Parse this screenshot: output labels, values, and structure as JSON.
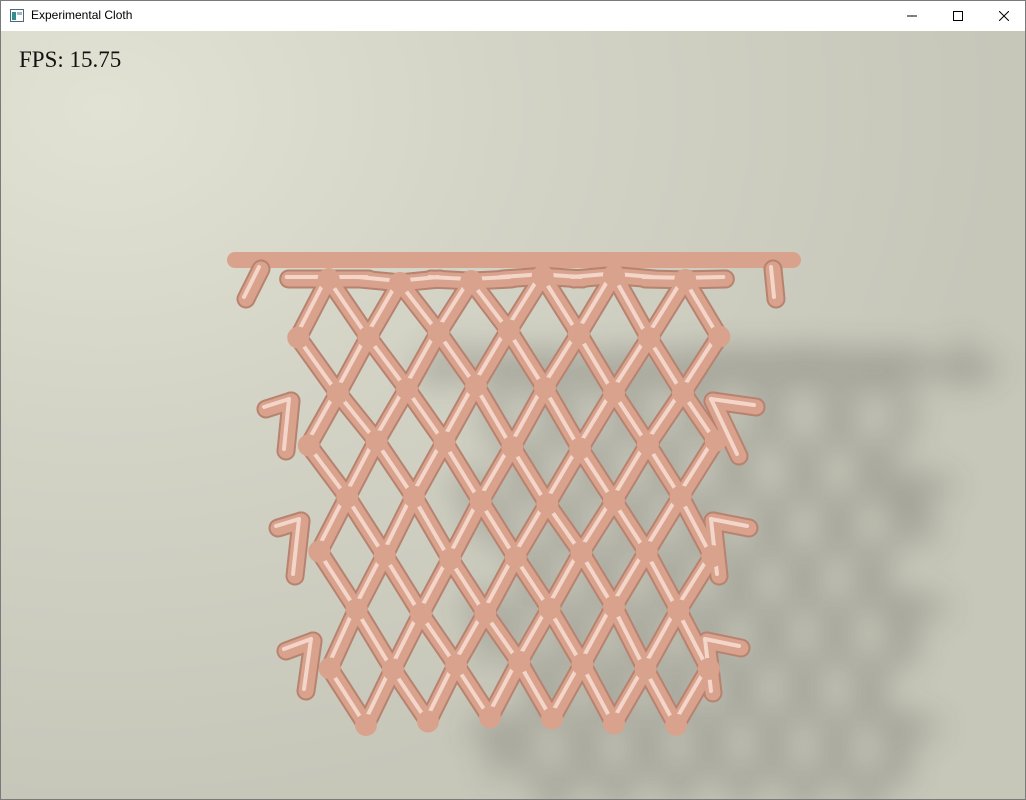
{
  "window": {
    "title": "Experimental Cloth"
  },
  "hud": {
    "fps_text": "FPS: 15.75"
  },
  "colors": {
    "cloth": "#d9a28d",
    "cloth_highlight": "#f3d6c9",
    "cloth_shadow": "#b7826f",
    "background": "#d6d6c9"
  },
  "icons": {
    "minimize": "minimize-icon",
    "maximize": "maximize-icon",
    "close": "close-icon"
  }
}
